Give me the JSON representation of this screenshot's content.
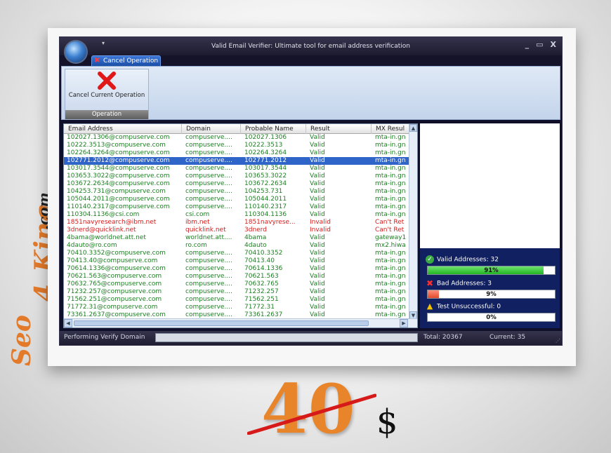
{
  "watermark": {
    "seo": "Seo",
    "four": "4",
    "king": "King",
    "com": ".com"
  },
  "window": {
    "title": "Valid Email Verifier: Ultimate tool for email address verification",
    "controls": [
      "_",
      "▭",
      "X"
    ],
    "quick_access": "▾"
  },
  "ribbon": {
    "tab_label": "Cancel Operation",
    "button_label": "Cancel Current Operation",
    "group_label": "Operation"
  },
  "grid": {
    "columns": [
      "Email Address",
      "Domain",
      "Probable Name",
      "Result",
      "MX Resul"
    ],
    "rows": [
      {
        "email": "102027.1306@compuserve.com",
        "domain": "compuserve....",
        "name": "102027.1306",
        "result": "Valid",
        "mx": "mta-in.gn",
        "status": "valid"
      },
      {
        "email": "10222.3513@compuserve.com",
        "domain": "compuserve....",
        "name": "10222.3513",
        "result": "Valid",
        "mx": "mta-in.gn",
        "status": "valid"
      },
      {
        "email": "102264.3264@compuserve.com",
        "domain": "compuserve....",
        "name": "102264.3264",
        "result": "Valid",
        "mx": "mta-in.gn",
        "status": "valid"
      },
      {
        "email": "102771.2012@compuserve.com",
        "domain": "compuserve....",
        "name": "102771.2012",
        "result": "Valid",
        "mx": "mta-in.gn",
        "status": "selected"
      },
      {
        "email": "103017.3544@compuserve.com",
        "domain": "compuserve....",
        "name": "103017.3544",
        "result": "Valid",
        "mx": "mta-in.gn",
        "status": "valid"
      },
      {
        "email": "103653.3022@compuserve.com",
        "domain": "compuserve....",
        "name": "103653.3022",
        "result": "Valid",
        "mx": "mta-in.gn",
        "status": "valid"
      },
      {
        "email": "103672.2634@compuserve.com",
        "domain": "compuserve....",
        "name": "103672.2634",
        "result": "Valid",
        "mx": "mta-in.gn",
        "status": "valid"
      },
      {
        "email": "104253.731@compuserve.com",
        "domain": "compuserve....",
        "name": "104253.731",
        "result": "Valid",
        "mx": "mta-in.gn",
        "status": "valid"
      },
      {
        "email": "105044.2011@compuserve.com",
        "domain": "compuserve....",
        "name": "105044.2011",
        "result": "Valid",
        "mx": "mta-in.gn",
        "status": "valid"
      },
      {
        "email": "110140.2317@compuserve.com",
        "domain": "compuserve....",
        "name": "110140.2317",
        "result": "Valid",
        "mx": "mta-in.gn",
        "status": "valid"
      },
      {
        "email": "110304.1136@csi.com",
        "domain": "csi.com",
        "name": "110304.1136",
        "result": "Valid",
        "mx": "mta-in.gn",
        "status": "valid"
      },
      {
        "email": "1851navyresearch@ibm.net",
        "domain": "ibm.net",
        "name": "1851navyrese...",
        "result": "Invalid",
        "mx": "Can't Ret",
        "status": "invalid"
      },
      {
        "email": "3dnerd@quicklink.net",
        "domain": "quicklink.net",
        "name": "3dnerd",
        "result": "Invalid",
        "mx": "Can't Ret",
        "status": "invalid"
      },
      {
        "email": "4bama@worldnet.att.net",
        "domain": "worldnet.att....",
        "name": "4bama",
        "result": "Valid",
        "mx": "gateway1",
        "status": "valid"
      },
      {
        "email": "4dauto@ro.com",
        "domain": "ro.com",
        "name": "4dauto",
        "result": "Valid",
        "mx": "mx2.hiwa",
        "status": "valid"
      },
      {
        "email": "70410.3352@compuserve.com",
        "domain": "compuserve....",
        "name": "70410.3352",
        "result": "Valid",
        "mx": "mta-in.gn",
        "status": "valid"
      },
      {
        "email": "70413.40@compuserve.com",
        "domain": "compuserve....",
        "name": "70413.40",
        "result": "Valid",
        "mx": "mta-in.gn",
        "status": "valid"
      },
      {
        "email": "70614.1336@compuserve.com",
        "domain": "compuserve....",
        "name": "70614.1336",
        "result": "Valid",
        "mx": "mta-in.gn",
        "status": "valid"
      },
      {
        "email": "70621.563@compuserve.com",
        "domain": "compuserve....",
        "name": "70621.563",
        "result": "Valid",
        "mx": "mta-in.gn",
        "status": "valid"
      },
      {
        "email": "70632.765@compuserve.com",
        "domain": "compuserve....",
        "name": "70632.765",
        "result": "Valid",
        "mx": "mta-in.gn",
        "status": "valid"
      },
      {
        "email": "71232.257@compuserve.com",
        "domain": "compuserve....",
        "name": "71232.257",
        "result": "Valid",
        "mx": "mta-in.gn",
        "status": "valid"
      },
      {
        "email": "71562.251@compuserve.com",
        "domain": "compuserve....",
        "name": "71562.251",
        "result": "Valid",
        "mx": "mta-in.gn",
        "status": "valid"
      },
      {
        "email": "71772.31@compuserve.com",
        "domain": "compuserve....",
        "name": "71772.31",
        "result": "Valid",
        "mx": "mta-in.gn",
        "status": "valid"
      },
      {
        "email": "73361.2637@compuserve.com",
        "domain": "compuserve....",
        "name": "73361.2637",
        "result": "Valid",
        "mx": "mta-in.gn",
        "status": "valid"
      }
    ]
  },
  "stats": {
    "valid_label": "Valid Addresses: 32",
    "valid_percent_text": "91%",
    "valid_fraction": 0.91,
    "bad_label": "Bad Addresses: 3",
    "bad_percent_text": "9%",
    "bad_fraction": 0.09,
    "unsuccessful_label": "Test Unsuccessful: 0",
    "unsuccessful_percent_text": "0%",
    "unsuccessful_fraction": 0
  },
  "statusbar": {
    "operation": "Performing Verify Domain",
    "total": "Total: 20367",
    "current": "Current: 35"
  },
  "price": {
    "amount": "40",
    "currency": "$"
  },
  "colors": {
    "valid": "#1c7f22",
    "invalid": "#d81a1a",
    "selected": "#2f64c8",
    "stats_panel": "#102060",
    "watermark": "#e37a2a"
  }
}
